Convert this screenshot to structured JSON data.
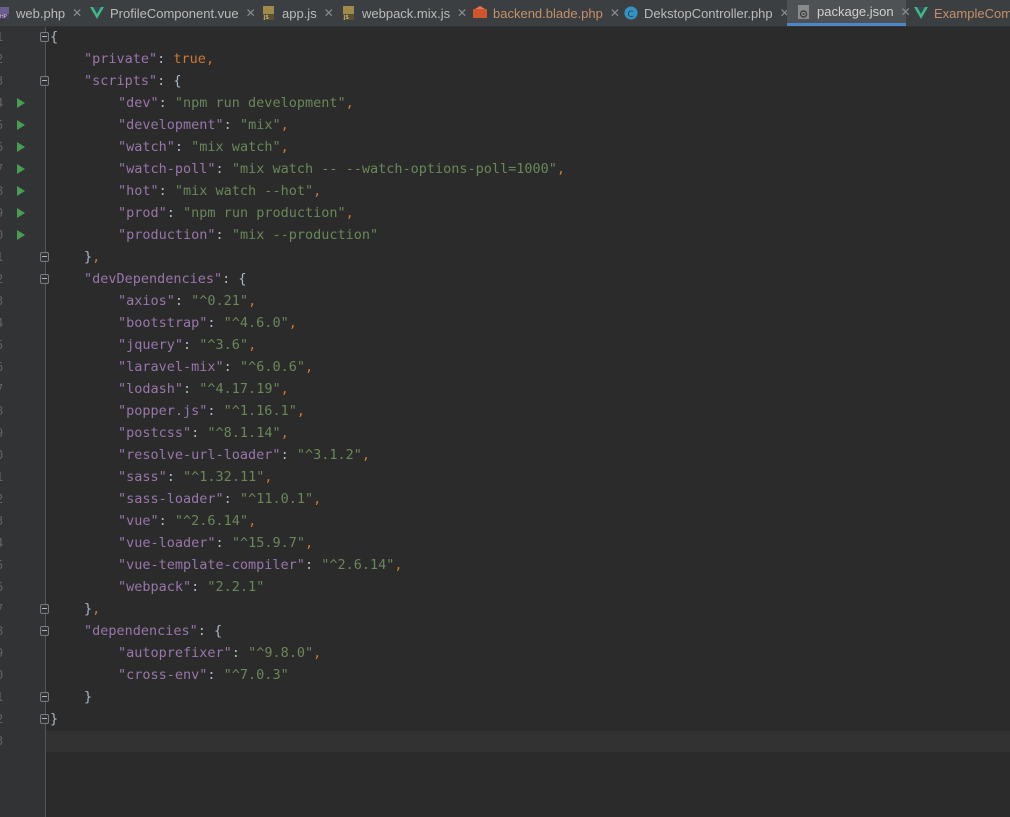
{
  "tabs": [
    {
      "label": "web.php",
      "icon": "php-file-icon",
      "active": false
    },
    {
      "label": "ProfileComponent.vue",
      "icon": "vue-file-icon",
      "active": false
    },
    {
      "label": "app.js",
      "icon": "js-file-icon",
      "active": false
    },
    {
      "label": "webpack.mix.js",
      "icon": "js-file-icon",
      "active": false
    },
    {
      "label": "backend.blade.php",
      "icon": "blade-file-icon",
      "active": false
    },
    {
      "label": "DekstopController.php",
      "icon": "class-file-icon",
      "active": false
    },
    {
      "label": "package.json",
      "icon": "json-file-icon",
      "active": true
    },
    {
      "label": "ExampleComp",
      "icon": "vue-file-icon",
      "active": false
    }
  ],
  "close_glyph": "✕",
  "colors": {
    "editor_bg": "#2b2b2b",
    "key": "#9876aa",
    "string": "#6a8759",
    "keyword": "#cc7832",
    "active_tab_underline": "#4a88c7",
    "run_icon": "#499c54"
  },
  "line_numbers": [
    "1",
    "2",
    "3",
    "4",
    "5",
    "6",
    "7",
    "8",
    "9",
    "0",
    "1",
    "2",
    "3",
    "4",
    "5",
    "6",
    "7",
    "8",
    "9",
    "0",
    "1",
    "2",
    "3",
    "4",
    "5",
    "6",
    "7",
    "8",
    "9",
    "0",
    "1",
    "2",
    "3"
  ],
  "code": {
    "open_brace": "{",
    "private_key": "\"private\"",
    "private_value": "true",
    "scripts_key": "\"scripts\"",
    "scripts": [
      {
        "key": "\"dev\"",
        "value": "\"npm run development\""
      },
      {
        "key": "\"development\"",
        "value": "\"mix\""
      },
      {
        "key": "\"watch\"",
        "value": "\"mix watch\""
      },
      {
        "key": "\"watch-poll\"",
        "value": "\"mix watch -- --watch-options-poll=1000\""
      },
      {
        "key": "\"hot\"",
        "value": "\"mix watch --hot\""
      },
      {
        "key": "\"prod\"",
        "value": "\"npm run production\""
      },
      {
        "key": "\"production\"",
        "value": "\"mix --production\""
      }
    ],
    "dev_dependencies_key": "\"devDependencies\"",
    "dev_dependencies": [
      {
        "key": "\"axios\"",
        "value": "\"^0.21\""
      },
      {
        "key": "\"bootstrap\"",
        "value": "\"^4.6.0\""
      },
      {
        "key": "\"jquery\"",
        "value": "\"^3.6\""
      },
      {
        "key": "\"laravel-mix\"",
        "value": "\"^6.0.6\""
      },
      {
        "key": "\"lodash\"",
        "value": "\"^4.17.19\""
      },
      {
        "key": "\"popper.js\"",
        "value": "\"^1.16.1\""
      },
      {
        "key": "\"postcss\"",
        "value": "\"^8.1.14\""
      },
      {
        "key": "\"resolve-url-loader\"",
        "value": "\"^3.1.2\""
      },
      {
        "key": "\"sass\"",
        "value": "\"^1.32.11\""
      },
      {
        "key": "\"sass-loader\"",
        "value": "\"^11.0.1\""
      },
      {
        "key": "\"vue\"",
        "value": "\"^2.6.14\""
      },
      {
        "key": "\"vue-loader\"",
        "value": "\"^15.9.7\""
      },
      {
        "key": "\"vue-template-compiler\"",
        "value": "\"^2.6.14\""
      },
      {
        "key": "\"webpack\"",
        "value": "\"2.2.1\""
      }
    ],
    "dependencies_key": "\"dependencies\"",
    "dependencies": [
      {
        "key": "\"autoprefixer\"",
        "value": "\"^9.8.0\""
      },
      {
        "key": "\"cross-env\"",
        "value": "\"^7.0.3\""
      }
    ],
    "close_brace": "}"
  }
}
